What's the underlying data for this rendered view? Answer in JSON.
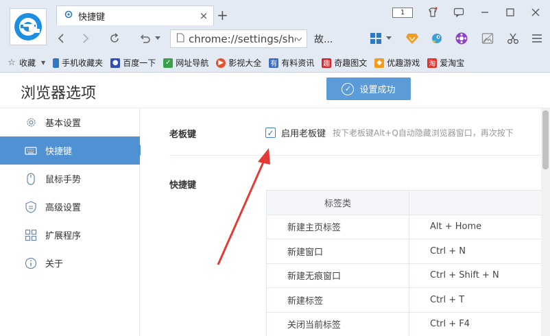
{
  "tab": {
    "title": "快捷键",
    "close": "×",
    "new": "+"
  },
  "window": {
    "page_badge": "1"
  },
  "address": {
    "url": "chrome://settings/sho",
    "search_label": "故..."
  },
  "bookmarks": [
    {
      "label": "收藏",
      "icon": "star-icon",
      "color": "#555555"
    },
    {
      "label": "手机收藏夹",
      "icon": "phone-icon",
      "color": "#2f78c4"
    },
    {
      "label": "百度一下",
      "icon": "baidu-paw-icon",
      "color": "#2f4fb5"
    },
    {
      "label": "网址导航",
      "icon": "hao-icon",
      "color": "#3aa14a"
    },
    {
      "label": "影视大全",
      "icon": "play-icon",
      "color": "#e4532f"
    },
    {
      "label": "有料资讯",
      "icon": "news-icon",
      "color": "#3b6fc7"
    },
    {
      "label": "奇趣图文",
      "icon": "qiqu-icon",
      "color": "#d8262c"
    },
    {
      "label": "优趣游戏",
      "icon": "game-icon",
      "color": "#f29c1f"
    },
    {
      "label": "爱淘宝",
      "icon": "taobao-icon",
      "color": "#e6302a"
    }
  ],
  "header": {
    "title": "浏览器选项",
    "success_label": "设置成功"
  },
  "sidebar": {
    "items": [
      {
        "label": "基本设置",
        "icon": "gear-icon",
        "active": false
      },
      {
        "label": "快捷键",
        "icon": "keyboard-icon",
        "active": true
      },
      {
        "label": "鼠标手势",
        "icon": "mouse-icon",
        "active": false
      },
      {
        "label": "高级设置",
        "icon": "shield-icon",
        "active": false
      },
      {
        "label": "扩展程序",
        "icon": "extension-icon",
        "active": false
      },
      {
        "label": "关于",
        "icon": "info-icon",
        "active": false
      }
    ]
  },
  "boss_key": {
    "section_label": "老板键",
    "checkbox_label": "启用老板键",
    "checked": true,
    "description": "按下老板键Alt+Q自动隐藏浏览器窗口，再次按下"
  },
  "shortcuts": {
    "section_label": "快捷键",
    "header": "标签类",
    "rows": [
      {
        "action": "新建主页标签",
        "keys": "Alt + Home"
      },
      {
        "action": "新建窗口",
        "keys": "Ctrl + N"
      },
      {
        "action": "新建无痕窗口",
        "keys": "Ctrl + Shift + N"
      },
      {
        "action": "新建标签",
        "keys": "Ctrl + T"
      },
      {
        "action": "关闭当前标签",
        "keys": "Ctrl + F4"
      }
    ]
  },
  "colors": {
    "accent": "#4f91d3",
    "success_button": "#5b9bd8",
    "annotation_arrow": "#e53935"
  }
}
